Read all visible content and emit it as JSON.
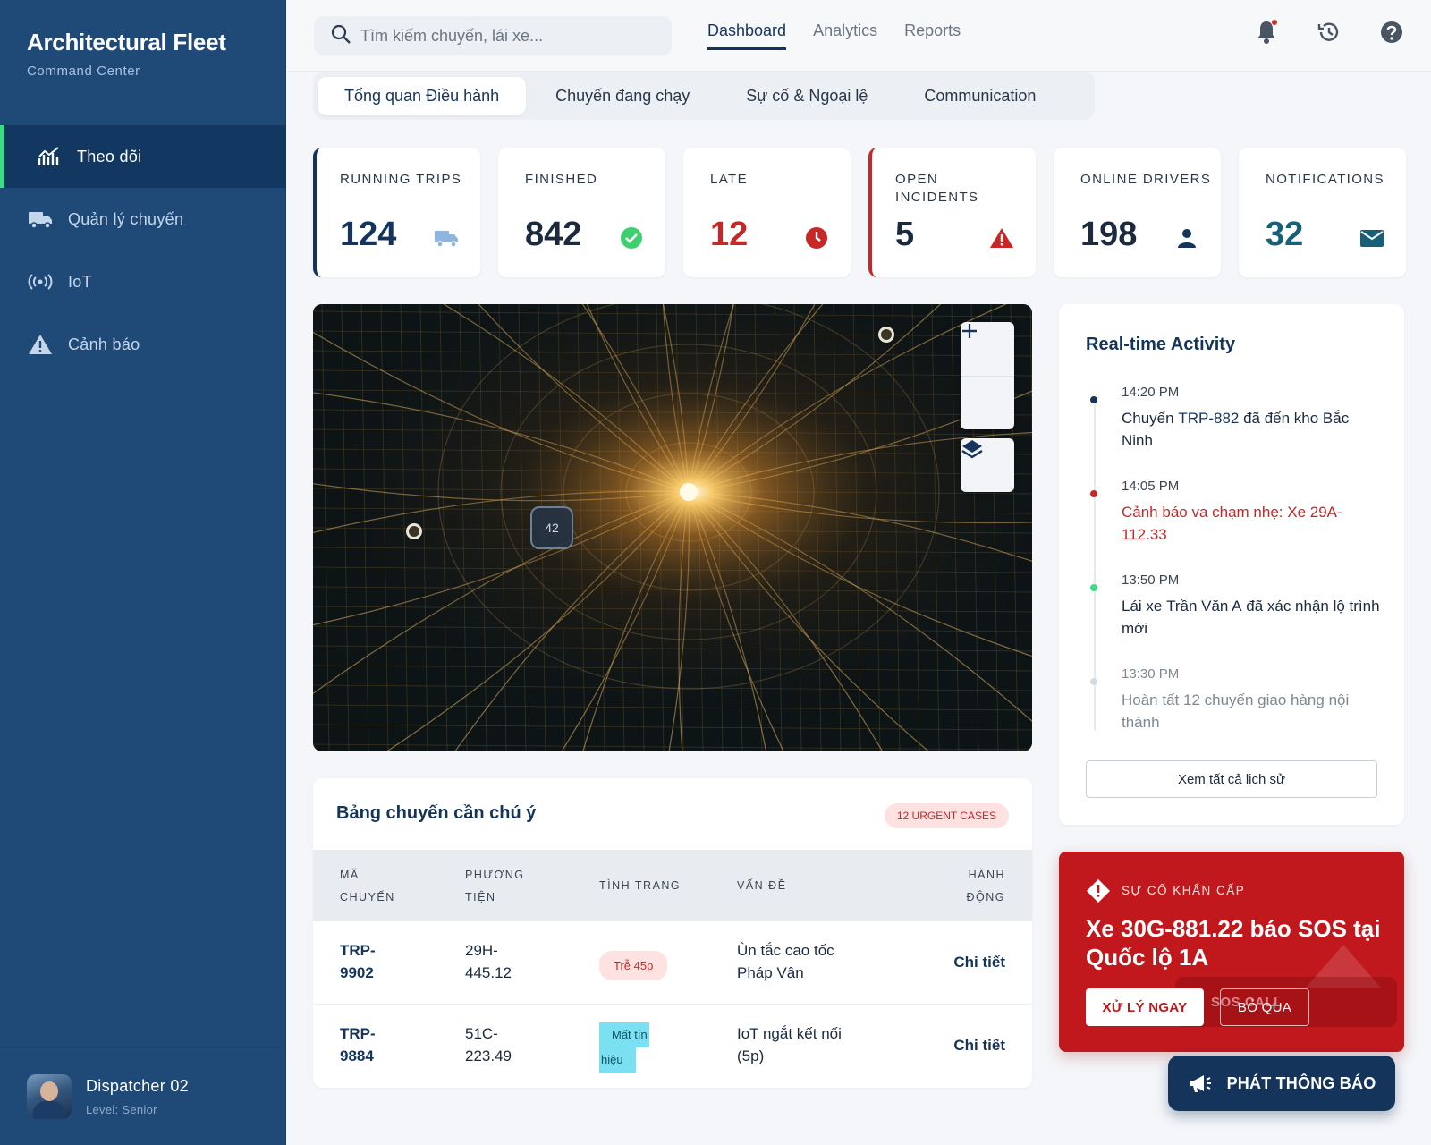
{
  "brand": {
    "title": "Architectural Fleet",
    "subtitle": "Command Center"
  },
  "sidebar": {
    "items": [
      {
        "label": "Theo dõi",
        "icon": "chart-icon",
        "active": true
      },
      {
        "label": "Quản lý chuyến",
        "icon": "truck-icon"
      },
      {
        "label": "IoT",
        "icon": "signal-icon"
      },
      {
        "label": "Cảnh báo",
        "icon": "warning-icon"
      }
    ]
  },
  "user": {
    "name": "Dispatcher 02",
    "level": "Level: Senior"
  },
  "topbar": {
    "search_placeholder": "Tìm kiếm chuyến, lái xe...",
    "tabs": [
      "Dashboard",
      "Analytics",
      "Reports"
    ],
    "active_tab": "Dashboard",
    "icons": [
      "bell-icon",
      "history-icon",
      "help-icon"
    ]
  },
  "subtabs": [
    "Tổng quan Điều hành",
    "Chuyến đang chạy",
    "Sự cố & Ngoại lệ",
    "Communication"
  ],
  "kpis": [
    {
      "label": "RUNNING TRIPS",
      "value": "124",
      "icon": "truck-icon",
      "color": "#15345c"
    },
    {
      "label": "FINISHED",
      "value": "842",
      "icon": "check-circle-icon",
      "color": "#1b2a3d"
    },
    {
      "label": "LATE",
      "value": "12",
      "icon": "clock-icon",
      "color": "#c62828"
    },
    {
      "label": "OPEN INCIDENTS",
      "value": "5",
      "icon": "warning-icon",
      "color": "#1b2a3d"
    },
    {
      "label": "ONLINE DRIVERS",
      "value": "198",
      "icon": "person-icon",
      "color": "#1b2a3d"
    },
    {
      "label": "NOTIFICATIONS",
      "value": "32",
      "icon": "mail-icon",
      "color": "#17607a"
    }
  ],
  "map": {
    "cluster_count": "42",
    "controls": [
      "zoom-in",
      "zoom-out",
      "layers"
    ]
  },
  "activity": {
    "title": "Real-time Activity",
    "items": [
      {
        "time": "14:20 PM",
        "pre": "Chuyến ",
        "ref": "TRP-882",
        "post": " đã đến kho Bắc Ninh",
        "dot": "#15345c"
      },
      {
        "time": "14:05 PM",
        "text": "Cảnh báo va chạm nhẹ: Xe 29A-112.33",
        "dot": "#c62828"
      },
      {
        "time": "13:50 PM",
        "pre": "Lái xe ",
        "ref": "Trần Văn A",
        "post": " đã xác nhận lộ trình mới",
        "dot": "#3ddc84"
      },
      {
        "time": "13:30 PM",
        "text": "Hoàn tất 12 chuyến giao hàng nội thành",
        "dot": "#d6dbe2"
      }
    ],
    "history_button": "Xem tất cả lịch sử"
  },
  "trips": {
    "title": "Bảng chuyến cần chú ý",
    "badge": "12 URGENT CASES",
    "headers": {
      "id": [
        "MÃ",
        "CHUYẾN"
      ],
      "vehicle": [
        "PHƯƠNG",
        "TIỆN"
      ],
      "status": "TÌNH TRẠNG",
      "issue": "VẤN ĐỀ",
      "action": [
        "HÀNH",
        "ĐỘNG"
      ]
    },
    "rows": [
      {
        "id": [
          "TRP-",
          "9902"
        ],
        "vehicle": [
          "29H-",
          "445.12"
        ],
        "status": "Trễ 45p",
        "issue": [
          "Ùn tắc cao tốc",
          "Pháp Vân"
        ],
        "action": "Chi tiết"
      },
      {
        "id": [
          "TRP-",
          "9884"
        ],
        "vehicle": [
          "51C-",
          "223.49"
        ],
        "status": [
          "Mất tín",
          "hiệu"
        ],
        "issue": [
          "IoT ngắt kết nối",
          "(5p)"
        ],
        "action": "Chi tiết"
      }
    ]
  },
  "emergency": {
    "label": "SỰ CỐ KHẨN CẤP",
    "title": "Xe 30G-881.22 báo SOS tại Quốc lộ 1A",
    "primary": "XỬ LÝ NGAY",
    "secondary": "BỎ QUA",
    "sos_ghost": "SOS CALL"
  },
  "broadcast": {
    "label": "PHÁT THÔNG BÁO"
  },
  "colors": {
    "sidebar": "#1f4a78",
    "navy": "#15345c",
    "red": "#c62828",
    "green": "#3ddc84",
    "emergency": "#c0181c"
  }
}
